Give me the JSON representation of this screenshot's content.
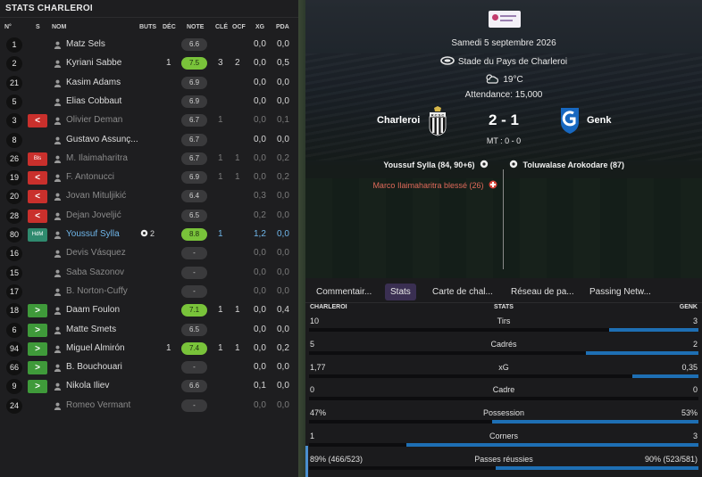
{
  "left_panel": {
    "title": "STATS CHARLEROI",
    "columns": {
      "num": "N°",
      "status": "S",
      "name": "NOM",
      "buts": "BUTS",
      "dec": "DÉC",
      "note": "NOTE",
      "cle": "CLÉ",
      "ocf": "OCF",
      "xg": "XG",
      "pda": "PDA"
    },
    "players": [
      {
        "num": "1",
        "status": "",
        "status_type": "",
        "name": "Matz Sels",
        "buts": "",
        "dec": "",
        "note": "6.6",
        "note_good": false,
        "cle": "",
        "ocf": "",
        "xg": "0,0",
        "pda": "0,0",
        "dim": false
      },
      {
        "num": "2",
        "status": "",
        "status_type": "",
        "name": "Kyriani Sabbe",
        "buts": "",
        "dec": "1",
        "note": "7.5",
        "note_good": true,
        "cle": "3",
        "ocf": "2",
        "xg": "0,0",
        "pda": "0,5",
        "dim": false
      },
      {
        "num": "21",
        "status": "",
        "status_type": "",
        "name": "Kasim Adams",
        "buts": "",
        "dec": "",
        "note": "6.9",
        "note_good": false,
        "cle": "",
        "ocf": "",
        "xg": "0,0",
        "pda": "0,0",
        "dim": false
      },
      {
        "num": "5",
        "status": "",
        "status_type": "",
        "name": "Elias Cobbaut",
        "buts": "",
        "dec": "",
        "note": "6.9",
        "note_good": false,
        "cle": "",
        "ocf": "",
        "xg": "0,0",
        "pda": "0,0",
        "dim": false
      },
      {
        "num": "3",
        "status": "<",
        "status_type": "red",
        "name": "Olivier Deman",
        "buts": "",
        "dec": "",
        "note": "6.7",
        "note_good": false,
        "cle": "1",
        "ocf": "",
        "xg": "0,0",
        "pda": "0,1",
        "dim": true
      },
      {
        "num": "8",
        "status": "",
        "status_type": "",
        "name": "Gustavo Assunç...",
        "buts": "",
        "dec": "",
        "note": "6.7",
        "note_good": false,
        "cle": "",
        "ocf": "",
        "xg": "0,0",
        "pda": "0,0",
        "dim": false
      },
      {
        "num": "26",
        "status": "Bls",
        "status_type": "inj",
        "name": "M. Ilaimaharitra",
        "buts": "",
        "dec": "",
        "note": "6.7",
        "note_good": false,
        "cle": "1",
        "ocf": "1",
        "xg": "0,0",
        "pda": "0,2",
        "dim": true
      },
      {
        "num": "19",
        "status": "<",
        "status_type": "red",
        "name": "F. Antonucci",
        "buts": "",
        "dec": "",
        "note": "6.9",
        "note_good": false,
        "cle": "1",
        "ocf": "1",
        "xg": "0,0",
        "pda": "0,2",
        "dim": true
      },
      {
        "num": "20",
        "status": "<",
        "status_type": "red",
        "name": "Jovan Mituljikić",
        "buts": "",
        "dec": "",
        "note": "6.4",
        "note_good": false,
        "cle": "",
        "ocf": "",
        "xg": "0,3",
        "pda": "0,0",
        "dim": true
      },
      {
        "num": "28",
        "status": "<",
        "status_type": "red",
        "name": "Dejan Joveljić",
        "buts": "",
        "dec": "",
        "note": "6.5",
        "note_good": false,
        "cle": "",
        "ocf": "",
        "xg": "0,2",
        "pda": "0,0",
        "dim": true
      },
      {
        "num": "80",
        "status": "HdM",
        "status_type": "tag",
        "name": "Youssuf Sylla",
        "buts": "2",
        "dec": "",
        "note": "8.8",
        "note_good": true,
        "cle": "1",
        "ocf": "",
        "xg": "1,2",
        "pda": "0,0",
        "dim": false,
        "highlight": true
      },
      {
        "num": "16",
        "status": "",
        "status_type": "",
        "name": "Devis Vásquez",
        "buts": "",
        "dec": "",
        "note": "-",
        "note_good": false,
        "cle": "",
        "ocf": "",
        "xg": "0,0",
        "pda": "0,0",
        "dim": true
      },
      {
        "num": "15",
        "status": "",
        "status_type": "",
        "name": "Saba Sazonov",
        "buts": "",
        "dec": "",
        "note": "-",
        "note_good": false,
        "cle": "",
        "ocf": "",
        "xg": "0,0",
        "pda": "0,0",
        "dim": true
      },
      {
        "num": "17",
        "status": "",
        "status_type": "",
        "name": "B. Norton-Cuffy",
        "buts": "",
        "dec": "",
        "note": "-",
        "note_good": false,
        "cle": "",
        "ocf": "",
        "xg": "0,0",
        "pda": "0,0",
        "dim": true
      },
      {
        "num": "18",
        "status": ">",
        "status_type": "green",
        "name": "Daam Foulon",
        "buts": "",
        "dec": "",
        "note": "7.1",
        "note_good": true,
        "cle": "1",
        "ocf": "1",
        "xg": "0,0",
        "pda": "0,4",
        "dim": false
      },
      {
        "num": "6",
        "status": ">",
        "status_type": "green",
        "name": "Matte Smets",
        "buts": "",
        "dec": "",
        "note": "6.5",
        "note_good": false,
        "cle": "",
        "ocf": "",
        "xg": "0,0",
        "pda": "0,0",
        "dim": false
      },
      {
        "num": "94",
        "status": ">",
        "status_type": "green",
        "name": "Miguel Almirón",
        "buts": "",
        "dec": "1",
        "note": "7.4",
        "note_good": true,
        "cle": "1",
        "ocf": "1",
        "xg": "0,0",
        "pda": "0,2",
        "dim": false
      },
      {
        "num": "66",
        "status": ">",
        "status_type": "green",
        "name": "B. Bouchouari",
        "buts": "",
        "dec": "",
        "note": "-",
        "note_good": false,
        "cle": "",
        "ocf": "",
        "xg": "0,0",
        "pda": "0,0",
        "dim": false
      },
      {
        "num": "9",
        "status": ">",
        "status_type": "green",
        "name": "Nikola Iliev",
        "buts": "",
        "dec": "",
        "note": "6.6",
        "note_good": false,
        "cle": "",
        "ocf": "",
        "xg": "0,1",
        "pda": "0,0",
        "dim": false
      },
      {
        "num": "24",
        "status": "",
        "status_type": "",
        "name": "Romeo Vermant",
        "buts": "",
        "dec": "",
        "note": "-",
        "note_good": false,
        "cle": "",
        "ocf": "",
        "xg": "0,0",
        "pda": "0,0",
        "dim": true
      }
    ]
  },
  "match": {
    "date": "Samedi 5 septembre 2026",
    "stadium": "Stade du Pays de Charleroi",
    "weather": "19°C",
    "attendance": "Attendance: 15,000",
    "home": "Charleroi",
    "away": "Genk",
    "score": "2 - 1",
    "halftime": "MT : 0 - 0",
    "home_scorer": "Youssuf Sylla (84, 90+6)",
    "away_scorer": "Toluwalase Arokodare (87)",
    "injury": "Marco Ilaimaharitra blessé (26)",
    "icons": {
      "stadium": "stadium-icon",
      "weather": "cloud-sun-icon",
      "goal": "ball-icon",
      "injury": "injury-icon"
    }
  },
  "tabs": [
    {
      "label": "Commentair..."
    },
    {
      "label": "Stats",
      "active": true
    },
    {
      "label": "Carte de chal..."
    },
    {
      "label": "Réseau de pa..."
    },
    {
      "label": "Passing Netw..."
    }
  ],
  "stats": {
    "head_home": "CHARLEROI",
    "head_center": "STATS",
    "head_away": "GENK",
    "rows": [
      {
        "label": "Tirs",
        "home": "10",
        "away": "3",
        "away_share": 0.23
      },
      {
        "label": "Cadrés",
        "home": "5",
        "away": "2",
        "away_share": 0.29
      },
      {
        "label": "xG",
        "home": "1,77",
        "away": "0,35",
        "away_share": 0.17
      },
      {
        "label": "Cadre",
        "home": "0",
        "away": "0",
        "away_share": 0.0
      },
      {
        "label": "Possession",
        "home": "47%",
        "away": "53%",
        "away_share": 0.53
      },
      {
        "label": "Corners",
        "home": "1",
        "away": "3",
        "away_share": 0.75
      },
      {
        "label": "Passes réussies",
        "home": "89% (466/523)",
        "away": "90% (523/581)",
        "away_share": 0.52
      }
    ]
  },
  "colors": {
    "accent_blue": "#1e6fb4",
    "note_good": "#79c33a",
    "status_red": "#c9302c",
    "status_green": "#3f9a3a"
  }
}
